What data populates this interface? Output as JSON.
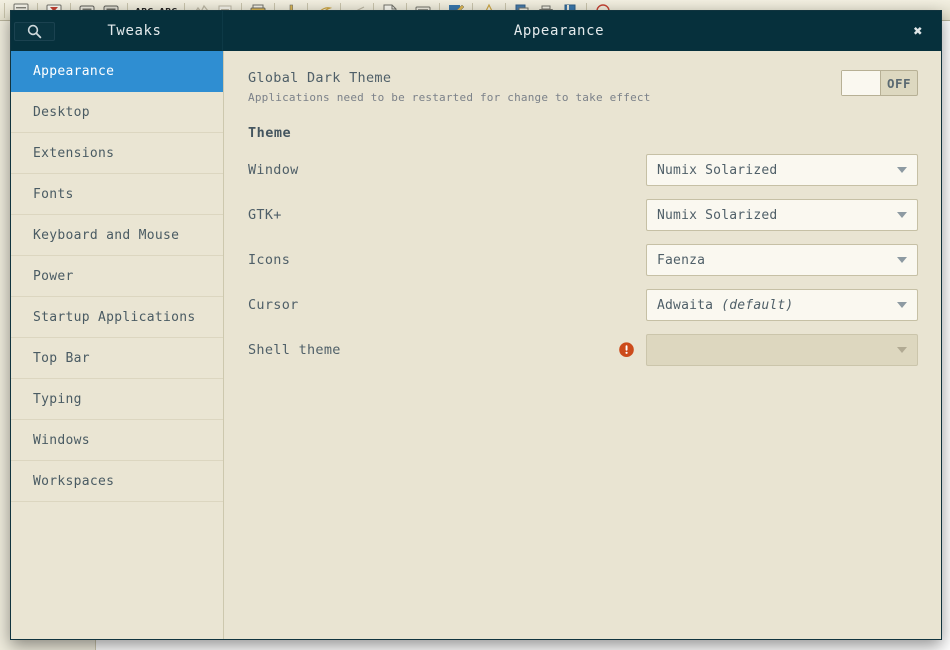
{
  "desktop": {
    "toolbar_icons": [
      "document-icon",
      "separator",
      "filter-icon",
      "separator",
      "card-icon",
      "card-filled-icon",
      "separator",
      "abc-spellcheck-icon",
      "abc-check-icon",
      "separator",
      "chart-icon",
      "lines-icon",
      "separator",
      "print-icon",
      "separator",
      "pencil-icon",
      "separator",
      "highlighter-icon",
      "separator",
      "line-icon",
      "separator",
      "page-icon",
      "separator",
      "keyboard-icon",
      "separator",
      "edit-document-icon",
      "separator",
      "bell-icon",
      "separator",
      "copy-icon",
      "printer-icon",
      "book-icon",
      "separator",
      "headphones-icon"
    ]
  },
  "window": {
    "title_bar": {
      "search_icon": "search-icon",
      "app_title": "Tweaks",
      "page_title": "Appearance",
      "close_label": "✖"
    }
  },
  "sidebar": {
    "items": [
      {
        "label": "Appearance",
        "selected": true
      },
      {
        "label": "Desktop",
        "selected": false
      },
      {
        "label": "Extensions",
        "selected": false
      },
      {
        "label": "Fonts",
        "selected": false
      },
      {
        "label": "Keyboard and Mouse",
        "selected": false
      },
      {
        "label": "Power",
        "selected": false
      },
      {
        "label": "Startup Applications",
        "selected": false
      },
      {
        "label": "Top Bar",
        "selected": false
      },
      {
        "label": "Typing",
        "selected": false
      },
      {
        "label": "Windows",
        "selected": false
      },
      {
        "label": "Workspaces",
        "selected": false
      }
    ]
  },
  "content": {
    "global_dark_theme": {
      "label": "Global Dark Theme",
      "description": "Applications need to be restarted for change to take effect",
      "toggle_state": "OFF",
      "toggle_on": false
    },
    "section_title": "Theme",
    "settings": [
      {
        "label": "Window",
        "value": "Numix Solarized",
        "value_suffix": "",
        "disabled": false,
        "warning": false
      },
      {
        "label": "GTK+",
        "value": "Numix Solarized",
        "value_suffix": "",
        "disabled": false,
        "warning": false
      },
      {
        "label": "Icons",
        "value": "Faenza",
        "value_suffix": "",
        "disabled": false,
        "warning": false
      },
      {
        "label": "Cursor",
        "value": "Adwaita ",
        "value_suffix": "(default)",
        "disabled": false,
        "warning": false
      },
      {
        "label": "Shell theme",
        "value": "",
        "value_suffix": "",
        "disabled": true,
        "warning": true,
        "warning_icon": "error-exclamation-icon"
      }
    ]
  },
  "colors": {
    "header_bg": "#06303c",
    "window_bg": "#e9e4d2",
    "sidebar_bg": "#eae5d3",
    "selected_item": "#2f8ed2",
    "field_bg": "#faf8f0",
    "warning": "#cc4b1b",
    "text": "#4f5f68"
  }
}
